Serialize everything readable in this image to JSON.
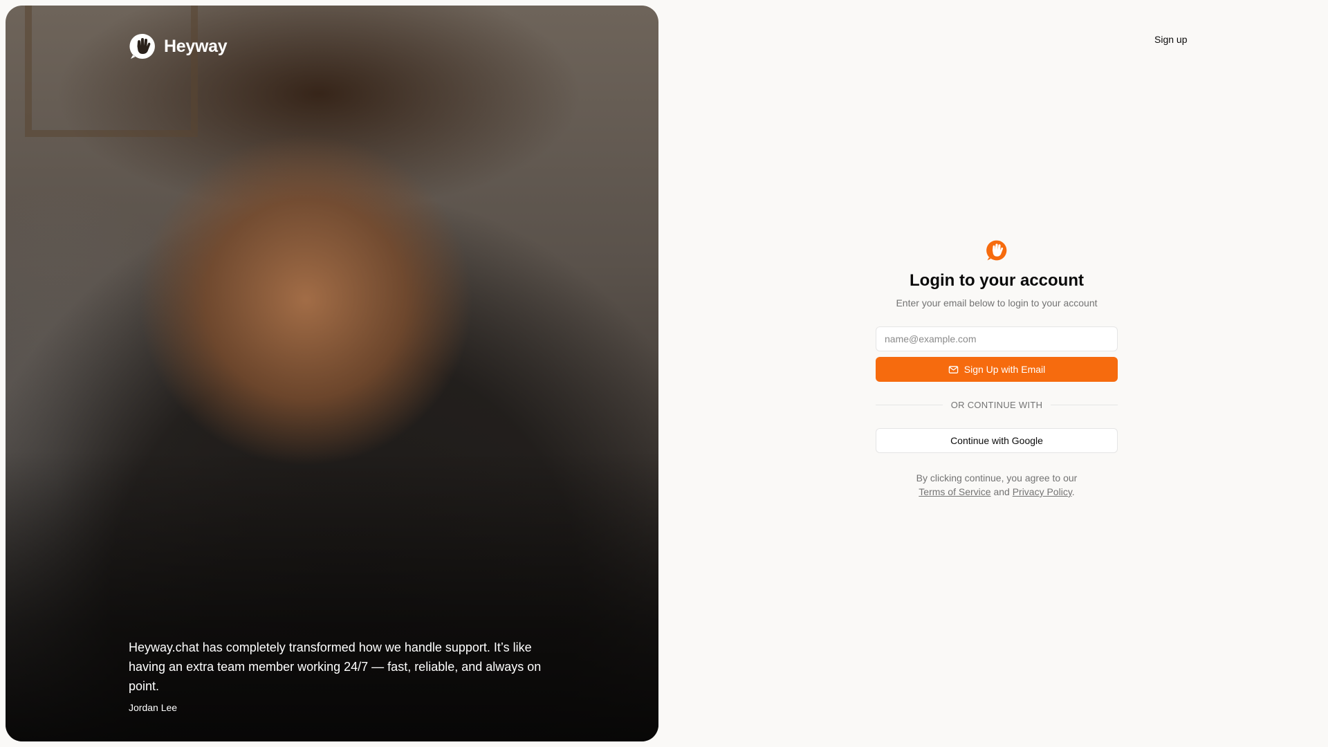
{
  "brand": {
    "name": "Heyway",
    "accent_color": "#f66b0e",
    "logo_icon": "waving-hand-chat-bubble-icon"
  },
  "hero": {
    "quote": "Heyway.chat has completely transformed how we handle support. It’s like having an extra team member working 24/7 — fast, reliable, and always on point.",
    "author": "Jordan Lee"
  },
  "header": {
    "signup_link": "Sign up"
  },
  "login": {
    "title": "Login to your account",
    "subtitle": "Enter your email below to login to your account",
    "email_placeholder": "name@example.com",
    "email_value": "",
    "submit_label": "Sign Up with Email",
    "submit_icon": "mail-icon",
    "divider_label": "OR CONTINUE WITH",
    "google_label": "Continue with Google",
    "legal_prefix": "By clicking continue, you agree to our",
    "terms_label": "Terms of Service",
    "legal_and": "and",
    "privacy_label": "Privacy Policy",
    "legal_suffix": "."
  }
}
